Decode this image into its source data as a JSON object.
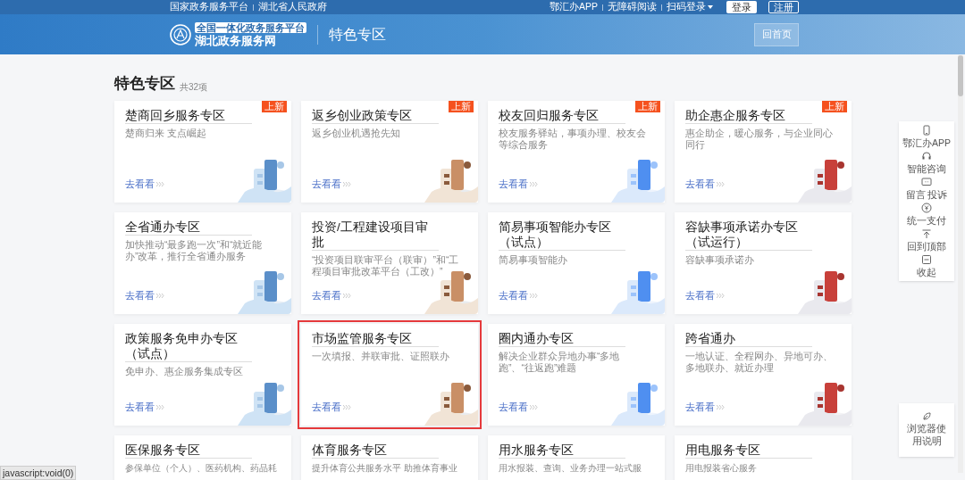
{
  "top_bar": {
    "left_links": [
      "国家政务服务平台",
      "湖北省人民政府"
    ],
    "right_links": [
      "鄂汇办APP",
      "无障碍阅读"
    ],
    "scan_login": "扫码登录",
    "login_button": "登录",
    "register_button": "注册"
  },
  "header": {
    "logo_tagline": "全国一体化政务服务平台",
    "logo_name": "湖北政务服务网",
    "page_title": "特色专区",
    "home_button": "回首页"
  },
  "section": {
    "title": "特色专区",
    "count": "共32项"
  },
  "cards": [
    {
      "title": "楚商回乡服务专区",
      "description": "楚商归来 支点崛起",
      "link": "去看看",
      "badge": "上新",
      "highlighted": false
    },
    {
      "title": "返乡创业政策专区",
      "description": "返乡创业机遇抢先知",
      "link": "去看看",
      "badge": "上新",
      "highlighted": false
    },
    {
      "title": "校友回归服务专区",
      "description": "校友服务驿站，事项办理、校友会等综合服务",
      "link": "去看看",
      "badge": "上新",
      "highlighted": false
    },
    {
      "title": "助企惠企服务专区",
      "description": "惠企助企，暖心服务，与企业同心同行",
      "link": "去看看",
      "badge": "上新",
      "highlighted": false
    },
    {
      "title": "全省通办专区",
      "description": "加快推动“最多跑一次”和“就近能办”改革，推行全省通办服务",
      "link": "去看看",
      "highlighted": false
    },
    {
      "title": "投资/工程建设项目审批",
      "description": "“投资项目联审平台（联审）”和“工程项目审批改革平台（工改）”",
      "link": "去看看",
      "highlighted": false
    },
    {
      "title": "简易事项智能办专区（试点）",
      "description": "简易事项智能办",
      "link": "去看看",
      "highlighted": false
    },
    {
      "title": "容缺事项承诺办专区（试运行）",
      "description": "容缺事项承诺办",
      "link": "去看看",
      "highlighted": false
    },
    {
      "title": "政策服务免申办专区（试点）",
      "description": "免申办、惠企服务集成专区",
      "link": "去看看",
      "highlighted": false
    },
    {
      "title": "市场监管服务专区",
      "description": "一次填报、并联审批、证照联办",
      "link": "去看看",
      "highlighted": true
    },
    {
      "title": "圈内通办专区",
      "description": "解决企业群众异地办事“多地跑”、“往返跑”难题",
      "link": "去看看",
      "highlighted": false
    },
    {
      "title": "跨省通办",
      "description": "一地认证、全程网办、异地可办、多地联办、就近办理",
      "link": "去看看",
      "highlighted": false
    },
    {
      "title": "医保服务专区",
      "description": "参保单位（个人）、医药机构、药品耗",
      "highlighted": false
    },
    {
      "title": "体育服务专区",
      "description": "提升体育公共服务水平 助推体育事业",
      "highlighted": false
    },
    {
      "title": "用水服务专区",
      "description": "用水报装、查询、业务办理一站式服",
      "highlighted": false
    },
    {
      "title": "用电服务专区",
      "description": "用电报装省心服务",
      "highlighted": false
    }
  ],
  "side_panel": [
    {
      "kind": "phone",
      "label": "鄂汇办APP"
    },
    {
      "kind": "headset",
      "label": "智能咨询"
    },
    {
      "kind": "chat",
      "label": "留言 投诉"
    },
    {
      "kind": "yen",
      "label": "统一支付"
    },
    {
      "kind": "top",
      "label": "回到顶部"
    },
    {
      "kind": "collapse",
      "label": "收起"
    }
  ],
  "browser_help": "浏览器使用说明",
  "status_tooltip": "javascript:void(0)"
}
